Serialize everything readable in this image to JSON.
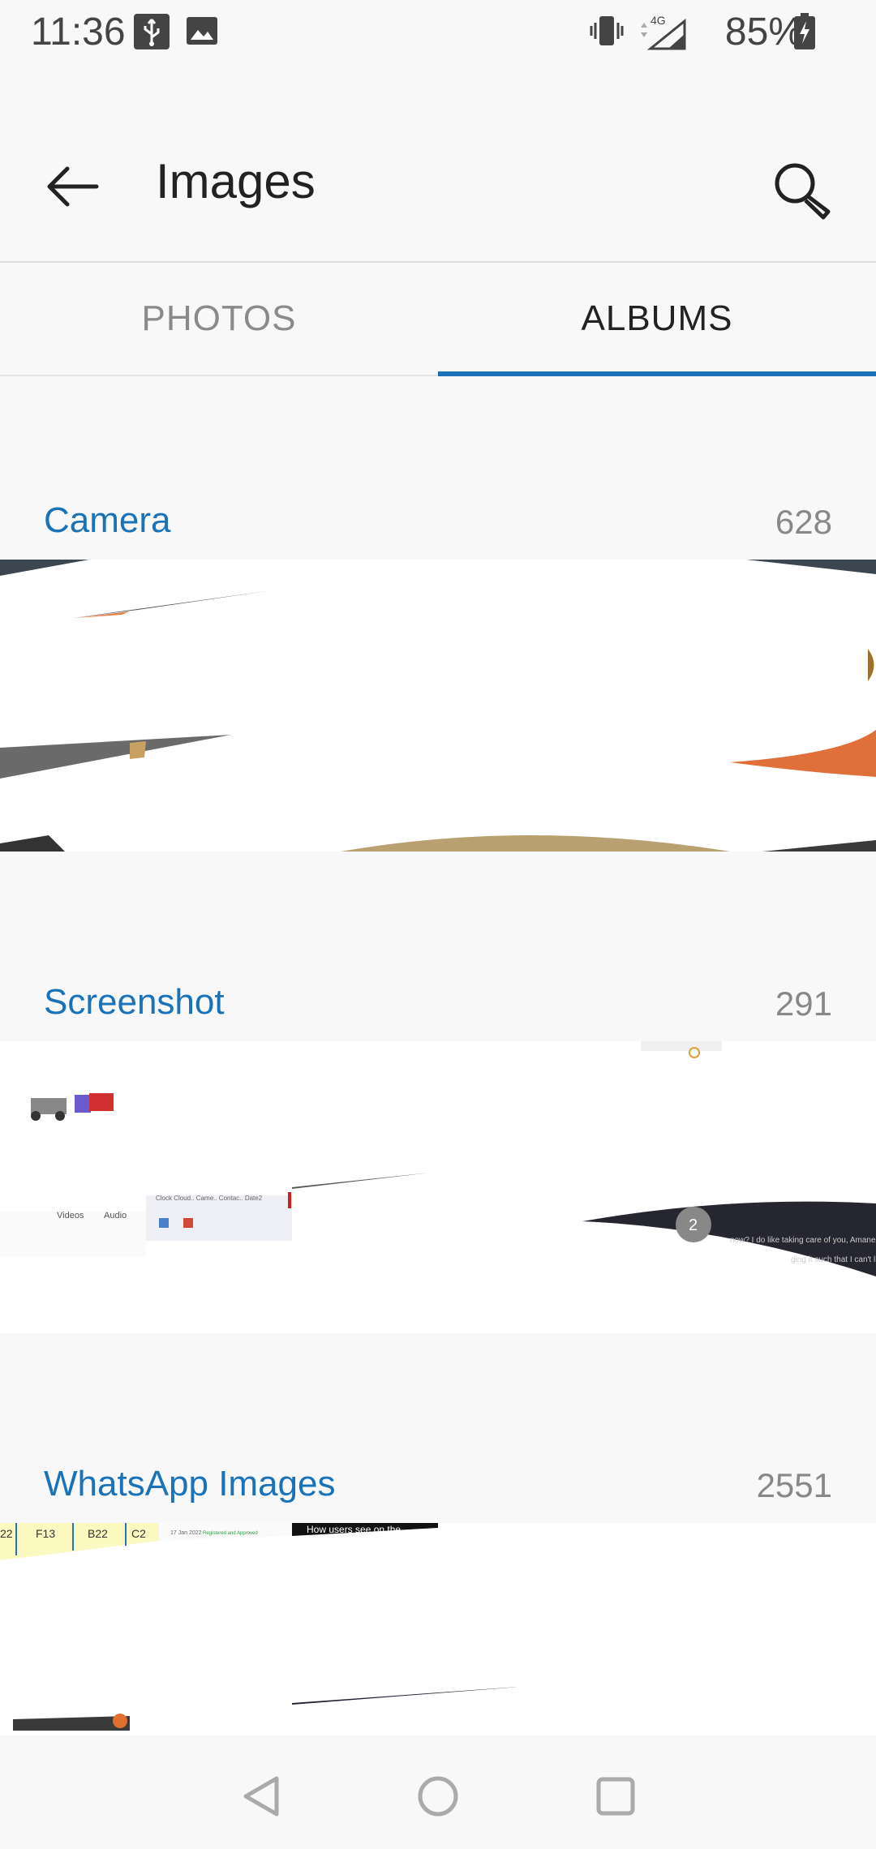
{
  "status_bar": {
    "time": "11:36",
    "battery": "85%",
    "network": "4G",
    "icons": [
      "usb-icon",
      "image-notification-icon",
      "vibrate-icon",
      "signal-icon",
      "battery-charging-icon"
    ]
  },
  "app_bar": {
    "title": "Images",
    "back_icon": "arrow-left-icon",
    "search_icon": "search-icon"
  },
  "tabs": [
    {
      "label": "PHOTOS",
      "selected": false
    },
    {
      "label": "ALBUMS",
      "selected": true
    }
  ],
  "colors": {
    "accent": "#1a73b8",
    "background": "#f8f8f8"
  },
  "albums": [
    {
      "name": "Camera",
      "count": "628"
    },
    {
      "name": "Screenshot",
      "count": "291"
    },
    {
      "name": "WhatsApp Images",
      "count": "2551"
    }
  ],
  "thumbnail_snippets": {
    "screenshot_videos": "Videos",
    "screenshot_audio": "Audio",
    "screenshot_tabs": "Clock   Cloud..   Came..   Contac..   Date2",
    "screenshot_num": "2",
    "screenshot_text1": "now? I do like taking care of you, Amane-ku",
    "screenshot_text2": "ging it such that I can't live",
    "whatsapp_cells": [
      "22",
      "F13",
      "B22",
      "C2"
    ],
    "whatsapp_date": "17 Jan 2022",
    "whatsapp_status": "Registered and Approved",
    "whatsapp_title": "How users see on the"
  },
  "nav_bar": {
    "icons": [
      "back-triangle-icon",
      "home-circle-icon",
      "recents-square-icon"
    ]
  }
}
